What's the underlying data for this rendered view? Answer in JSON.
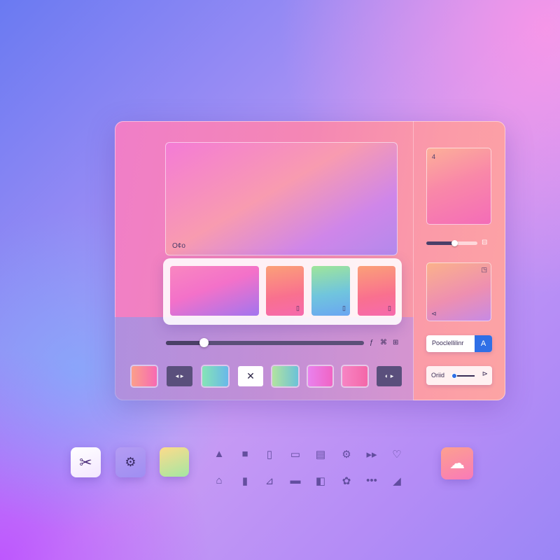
{
  "editor": {
    "hero_label": "O¢o",
    "thumbnails": [
      {
        "tag": ""
      },
      {
        "tag": "▯"
      },
      {
        "tag": "▯"
      },
      {
        "tag": "▯"
      }
    ],
    "scrubber": {
      "progress": 0.19,
      "controls": [
        "ƒ",
        "⌘",
        "⊞"
      ]
    },
    "tray": [
      {
        "kind": "swatch",
        "label": ""
      },
      {
        "kind": "dark",
        "label": "◂ ▸"
      },
      {
        "kind": "swatch",
        "label": ""
      },
      {
        "kind": "close",
        "label": "✕"
      },
      {
        "kind": "swatch",
        "label": ""
      },
      {
        "kind": "swatch",
        "label": ""
      },
      {
        "kind": "swatch",
        "label": ""
      },
      {
        "kind": "dark",
        "label": "◐ ▸"
      }
    ]
  },
  "side_panel": {
    "card1_tag": "4",
    "slider_value": 0.55,
    "slider_end_icon": "⊟",
    "card2_tags": [
      "◳",
      "⊲"
    ],
    "input_text": "Pooclellilinr",
    "input_button_icon": "A",
    "slider_row_label": "Oriid",
    "slider_row_end": "⊳"
  },
  "dock": {
    "tiles": [
      {
        "icon": "tools-icon",
        "glyph": "✂"
      },
      {
        "icon": "settings-icon",
        "glyph": "⚙"
      },
      {
        "icon": "gradient-swatch-icon",
        "glyph": ""
      },
      {
        "icon": "photos-icon",
        "glyph": "☁"
      }
    ],
    "row1_icons": [
      "▲",
      "■",
      "▯",
      "▭",
      "▤",
      "⚙",
      "▸▸",
      "♡"
    ],
    "row2_icons": [
      "⌂",
      "▮",
      "⊿",
      "▬",
      "◧",
      "✿",
      "•••",
      "◢"
    ]
  }
}
